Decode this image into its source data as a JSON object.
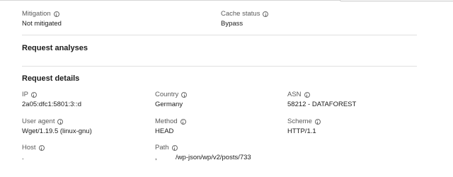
{
  "top_fields": {
    "mitigation": {
      "label": "Mitigation",
      "value": "Not mitigated"
    },
    "cache_status": {
      "label": "Cache status",
      "value": "Bypass"
    }
  },
  "sections": {
    "request_analyses": {
      "title": "Request analyses"
    },
    "request_details": {
      "title": "Request details"
    }
  },
  "details": {
    "ip": {
      "label": "IP",
      "value": "2a05:dfc1:5801:3::d"
    },
    "country": {
      "label": "Country",
      "value": "Germany"
    },
    "asn": {
      "label": "ASN",
      "value": "58212 - DATAFOREST"
    },
    "user_agent": {
      "label": "User agent",
      "value": "Wget/1.19.5 (linux-gnu)"
    },
    "method": {
      "label": "Method",
      "value": "HEAD"
    },
    "scheme": {
      "label": "Scheme",
      "value": "HTTP/1.1"
    },
    "host": {
      "label": "Host",
      "value": "."
    },
    "path": {
      "label": "Path",
      "value": ",          /wp-json/wp/v2/posts/733"
    }
  },
  "icons": {
    "info": "info-circle-icon"
  }
}
